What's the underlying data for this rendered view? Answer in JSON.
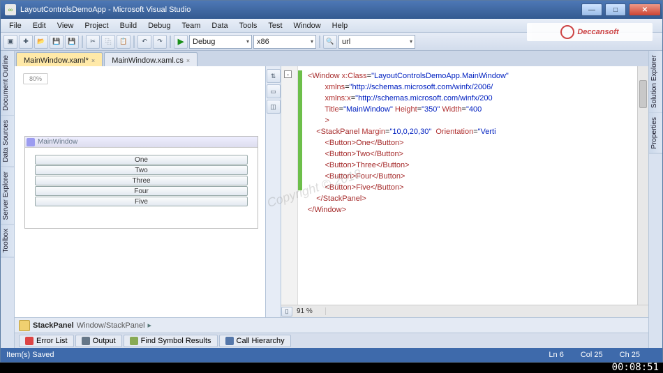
{
  "window": {
    "title": "LayoutControlsDemoApp - Microsoft Visual Studio"
  },
  "menus": [
    "File",
    "Edit",
    "View",
    "Project",
    "Build",
    "Debug",
    "Team",
    "Data",
    "Tools",
    "Test",
    "Window",
    "Help"
  ],
  "toolbar": {
    "config": "Debug",
    "platform": "x86",
    "find": "url"
  },
  "logo": "Deccansoft",
  "leftTabs": [
    "Document Outline",
    "Data Sources",
    "Server Explorer",
    "Toolbox"
  ],
  "rightTabs": [
    "Solution Explorer",
    "Properties"
  ],
  "docTabs": [
    {
      "label": "MainWindow.xaml*",
      "active": true
    },
    {
      "label": "MainWindow.xaml.cs",
      "active": false
    }
  ],
  "designer": {
    "zoom": "80%",
    "title": "MainWindow",
    "buttons": [
      "One",
      "Two",
      "Three",
      "Four",
      "Five"
    ]
  },
  "code": {
    "zoom": "91 %",
    "tokens": {
      "winOpen": "<Window",
      "xclass_a": "x:Class",
      "xclass_v": "\"LayoutControlsDemoApp.MainWindow\"",
      "xmlns_a": "xmlns",
      "xmlns_v": "\"http://schemas.microsoft.com/winfx/2006/",
      "xmlnsx_a": "xmlns:x",
      "xmlnsx_v": "\"http://schemas.microsoft.com/winfx/200",
      "title_a": "Title",
      "title_v": "\"MainWindow\"",
      "height_a": "Height",
      "height_v": "\"350\"",
      "width_a": "Width",
      "width_v": "\"400",
      "close1": ">",
      "sp_open": "<StackPanel",
      "margin_a": "Margin",
      "margin_v": "\"10,0,20,30\"",
      "orient_a": "Orientation",
      "orient_v": "\"Verti",
      "b1": "<Button>One</Button>",
      "b2": "<Button>Two</Button>",
      "b3": "<Button>Three</Button>",
      "b4": "<Button>Four</Button>",
      "b5": "<Button>Five</Button>",
      "sp_close": "</StackPanel>",
      "win_close": "</Window>"
    }
  },
  "breadcrumb": {
    "element": "StackPanel",
    "path": "Window/StackPanel"
  },
  "bottomTabs": [
    "Error List",
    "Output",
    "Find Symbol Results",
    "Call Hierarchy"
  ],
  "status": {
    "left": "Item(s) Saved",
    "ln": "Ln 6",
    "col": "Col 25",
    "ch": "Ch 25"
  },
  "video": {
    "time": "00:08:51"
  },
  "watermark": "Copyright © 2018"
}
